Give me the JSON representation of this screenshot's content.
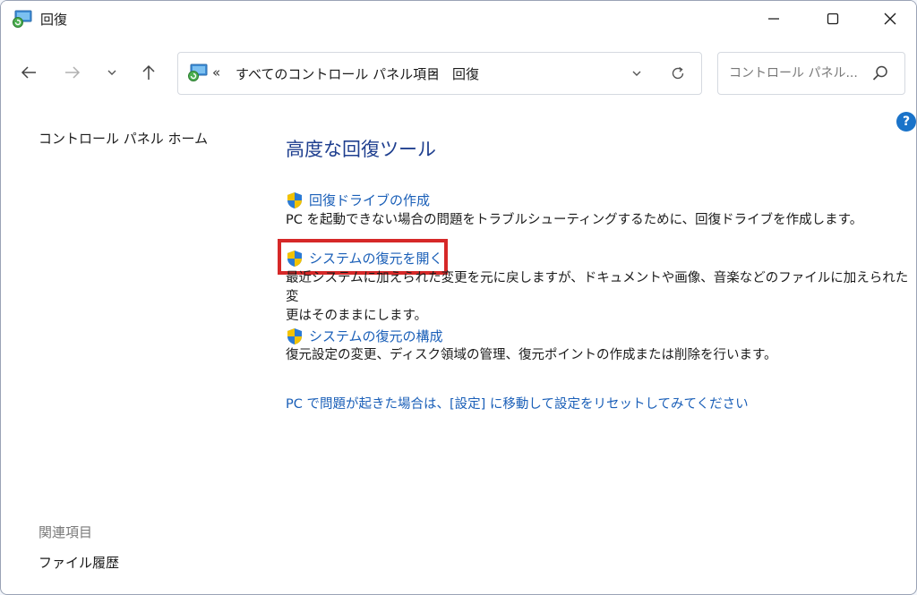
{
  "window": {
    "title": "回復"
  },
  "nav": {
    "back_icon": "arrow-left-icon",
    "forward_icon": "arrow-right-icon",
    "recent_icon": "chevron-down-icon",
    "up_icon": "arrow-up-icon"
  },
  "address_bar": {
    "overflow": "«",
    "path": [
      "すべてのコントロール パネル項目",
      "回復"
    ],
    "separator": "›"
  },
  "search": {
    "placeholder": "コントロール パネル..."
  },
  "sidebar": {
    "home_link": "コントロール パネル ホーム",
    "related_heading": "関連項目",
    "related_items": [
      "ファイル履歴"
    ]
  },
  "main": {
    "heading": "高度な回復ツール",
    "items": [
      {
        "link": "回復ドライブの作成",
        "description": "PC を起動できない場合の問題をトラブルシューティングするために、回復ドライブを作成します。"
      },
      {
        "link": "システムの復元を開く",
        "description_line1": "最近システムに加えられた変更を元に戻しますが、ドキュメントや画像、音楽などのファイルに加えられた変",
        "description_line2": "更はそのままにします。"
      },
      {
        "link": "システムの復元の構成",
        "description": "復元設定の変更、ディスク領域の管理、復元ポイントの作成または削除を行います。"
      }
    ],
    "reset_link": "PC で問題が起きた場合は、[設定] に移動して設定をリセットしてみてください"
  },
  "help": {
    "label": "?"
  },
  "colors": {
    "link": "#1a5fb8",
    "heading": "#1f3f8f",
    "highlight": "#d62828",
    "help": "#1a73c9"
  }
}
